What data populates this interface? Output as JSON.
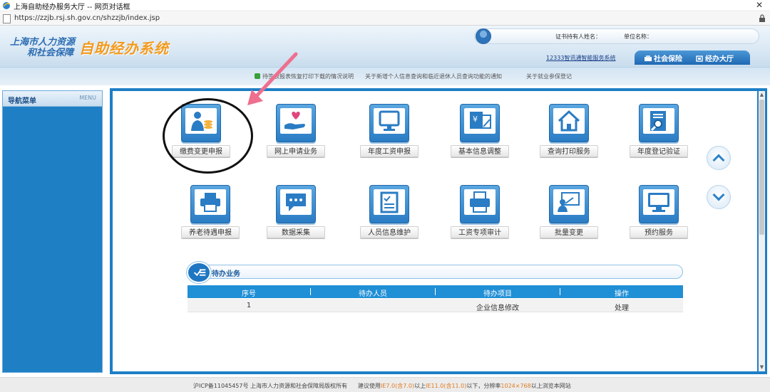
{
  "window": {
    "title": "上海自助经办服务大厅 -- 网页对话框",
    "url": "https://zzjb.rsj.sh.gov.cn/shzzjb/index.jsp"
  },
  "header": {
    "logo_line1": "上海市人力资源",
    "logo_line2": "和社会保障",
    "system_name": "自助经办系统",
    "holder_label": "证书持有人姓名：",
    "unit_label": "单位名称：",
    "service_link": "12333智讯通智能服务系统",
    "tabs": [
      {
        "label": "社会保险",
        "icon": "shield-icon"
      },
      {
        "label": "经办大厅",
        "icon": "hall-icon"
      }
    ]
  },
  "notices": [
    "待签收报表恢复打印下载的情况说明",
    "关于新增个人信息查询和临近退休人员查询功能的通知",
    "关于就业参保登记"
  ],
  "sidebar": {
    "title": "导航菜单",
    "title_en": "MENU"
  },
  "services": [
    {
      "label": "缴费变更申报",
      "icon": "person-coins-icon"
    },
    {
      "label": "网上申请业务",
      "icon": "hand-heart-icon"
    },
    {
      "label": "年度工资申报",
      "icon": "monitor-icon"
    },
    {
      "label": "基本信息调整",
      "icon": "yen-document-icon"
    },
    {
      "label": "查询打印服务",
      "icon": "house-icon"
    },
    {
      "label": "年度登记验证",
      "icon": "document-search-icon"
    },
    {
      "label": "养老待遇申报",
      "icon": "printer-icon"
    },
    {
      "label": "数据采集",
      "icon": "chat-bubble-icon"
    },
    {
      "label": "人员信息维护",
      "icon": "checklist-icon"
    },
    {
      "label": "工资专项审计",
      "icon": "fax-icon"
    },
    {
      "label": "批量变更",
      "icon": "presentation-icon"
    },
    {
      "label": "预约服务",
      "icon": "display-icon"
    }
  ],
  "pending": {
    "title": "待办业务",
    "columns": [
      "序号",
      "待办人员",
      "待办项目",
      "操作"
    ],
    "rows": [
      {
        "index": "1",
        "person": "",
        "item": "企业信息修改",
        "action": "处理"
      }
    ]
  },
  "footer": {
    "icp": "沪ICP备11045457号",
    "copyright": "上海市人力资源和社会保障局版权所有",
    "advice_prefix": "建议使用",
    "browser1": "IE7.0(含7.0)",
    "advice_mid1": "以上",
    "browser2": "IE11.0(含11.0)",
    "advice_mid2": "以下，分辨率",
    "resolution": "1024×768",
    "advice_suffix": "以上浏览本网站"
  }
}
